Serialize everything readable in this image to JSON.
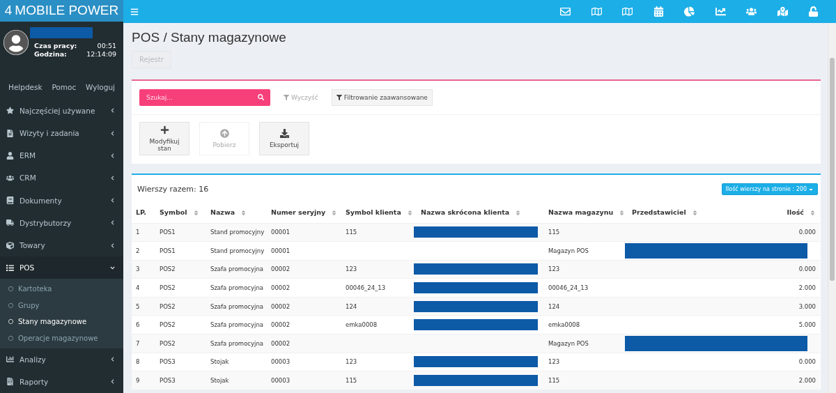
{
  "logo": {
    "number": "4",
    "text": "MOBILE POWER"
  },
  "user": {
    "work_time_label": "Czas pracy:",
    "work_time": "00:51",
    "clock_label": "Godzina:",
    "clock": "12:14:09"
  },
  "user_links": [
    "Helpdesk",
    "Pomoc",
    "Wyloguj"
  ],
  "sidebar": {
    "items": [
      {
        "label": "Najczęściej używane",
        "expanded": false
      },
      {
        "label": "Wizyty i zadania",
        "expanded": false
      },
      {
        "label": "ERM",
        "expanded": false
      },
      {
        "label": "CRM",
        "expanded": false
      },
      {
        "label": "Dokumenty",
        "expanded": false
      },
      {
        "label": "Dystrybutorzy",
        "expanded": false
      },
      {
        "label": "Towary",
        "expanded": false
      },
      {
        "label": "POS",
        "expanded": true,
        "children": [
          {
            "label": "Kartoteka",
            "selected": false
          },
          {
            "label": "Grupy",
            "selected": false
          },
          {
            "label": "Stany magazynowe",
            "selected": true
          },
          {
            "label": "Operacje magazynowe",
            "selected": false
          }
        ]
      },
      {
        "label": "Analizy",
        "expanded": false
      },
      {
        "label": "Raporty",
        "expanded": false
      }
    ]
  },
  "page_title": "POS / Stany magazynowe",
  "tabs": [
    {
      "label": "Rejestr",
      "disabled": true
    }
  ],
  "search": {
    "placeholder": "Szukaj..."
  },
  "filter_buttons": [
    {
      "label": "Wyczyść",
      "disabled": true
    },
    {
      "label": "Filtrowanie zaawansowane",
      "disabled": false
    }
  ],
  "actions": [
    {
      "label": "Modyfikuj stan",
      "disabled": false
    },
    {
      "label": "Pobierz",
      "disabled": true
    },
    {
      "label": "Eksportuj",
      "disabled": false
    }
  ],
  "table": {
    "total": "Wierszy razem: 16",
    "page_size": "Ilość wierszy na stronie : 200",
    "columns": [
      {
        "label": "LP.",
        "sortable": false
      },
      {
        "label": "Symbol",
        "sortable": true
      },
      {
        "label": "Nazwa",
        "sortable": true
      },
      {
        "label": "Numer seryjny",
        "sortable": true
      },
      {
        "label": "Symbol klienta",
        "sortable": true
      },
      {
        "label": "Nazwa skrócona klienta",
        "sortable": true
      },
      {
        "label": "Nazwa magazynu",
        "sortable": true
      },
      {
        "label": "Przedstawiciel",
        "sortable": true
      },
      {
        "label": "Ilość",
        "sortable": true
      }
    ],
    "rows": [
      {
        "cells": [
          "1",
          "POS1",
          "Stand promocyjny",
          "00001",
          "115",
          "",
          "115",
          "",
          "0.000"
        ],
        "kind": "client"
      },
      {
        "cells": [
          "2",
          "POS1",
          "Stand promocyjny",
          "00001",
          "",
          "",
          "Magazyn POS",
          "",
          ""
        ],
        "kind": "representative"
      },
      {
        "cells": [
          "3",
          "POS2",
          "Szafa promocyjna",
          "00002",
          "123",
          "",
          "123",
          "",
          "0.000"
        ],
        "kind": "client"
      },
      {
        "cells": [
          "4",
          "POS2",
          "Szafa promocyjna",
          "00002",
          "00046_24_13",
          "",
          "00046_24_13",
          "",
          "2.000"
        ],
        "kind": "client"
      },
      {
        "cells": [
          "5",
          "POS2",
          "Szafa promocyjna",
          "00002",
          "124",
          "",
          "124",
          "",
          "3.000"
        ],
        "kind": "client"
      },
      {
        "cells": [
          "6",
          "POS2",
          "Szafa promocyjna",
          "00002",
          "emka0008",
          "",
          "emka0008",
          "",
          "5.000"
        ],
        "kind": "client"
      },
      {
        "cells": [
          "7",
          "POS2",
          "Szafa promocyjna",
          "00002",
          "",
          "",
          "Magazyn POS",
          "",
          ""
        ],
        "kind": "representative"
      },
      {
        "cells": [
          "8",
          "POS3",
          "Stojak",
          "00003",
          "123",
          "",
          "123",
          "",
          "0.000"
        ],
        "kind": "client"
      },
      {
        "cells": [
          "9",
          "POS3",
          "Stojak",
          "00003",
          "115",
          "",
          "115",
          "",
          "2.000"
        ],
        "kind": "client"
      }
    ]
  }
}
